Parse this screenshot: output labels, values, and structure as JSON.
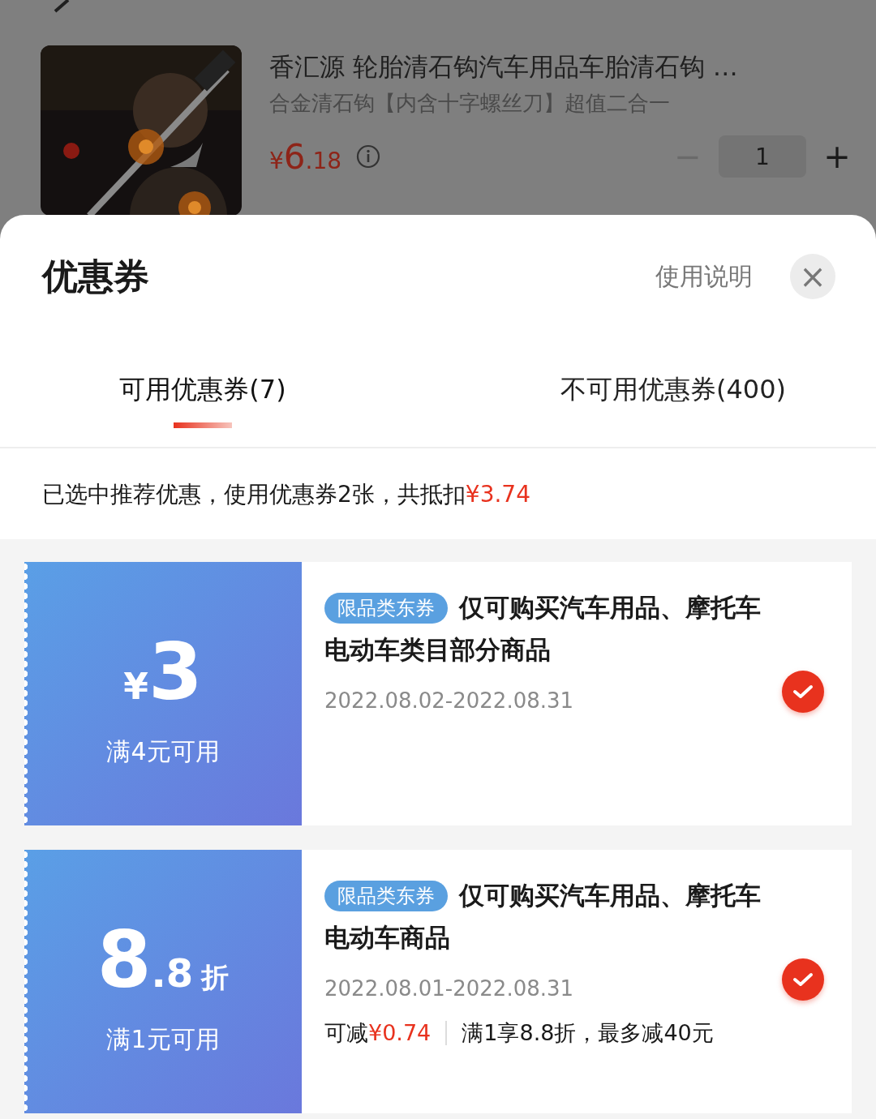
{
  "product": {
    "title": "香汇源 轮胎清石钩汽车用品车胎清石钩 …",
    "subtitle": "合金清石钩【内含十字螺丝刀】超值二合一",
    "price_symbol": "¥",
    "price_int": "6",
    "price_dec": ".18",
    "quantity": "1",
    "minus": "−",
    "plus": "+"
  },
  "sheet": {
    "title": "优惠券",
    "help": "使用说明",
    "close": "×"
  },
  "tabs": [
    {
      "label": "可用优惠券(7)",
      "selected": true
    },
    {
      "label": "不可用优惠券(400)",
      "selected": false
    }
  ],
  "summary": {
    "text": "已选中推荐优惠，使用优惠券2张，共抵扣",
    "amount": "¥3.74"
  },
  "coupons": [
    {
      "kind": "cash",
      "currency": "¥",
      "amount": "3",
      "condition": "满4元可用",
      "tag": "限品类东券",
      "title": "仅可购买汽车用品、摩托车电动车类目部分商品",
      "dates": "2022.08.02-2022.08.31",
      "checked": true
    },
    {
      "kind": "discount",
      "amount": "8",
      "decimal": ".8",
      "unit": "折",
      "condition": "满1元可用",
      "tag": "限品类东券",
      "title": "仅可购买汽车用品、摩托车电动车商品",
      "dates": "2022.08.01-2022.08.31",
      "checked": true,
      "saving_label": "可减",
      "saving": "¥0.74",
      "rule": "满1享8.8折，最多减40元"
    }
  ]
}
